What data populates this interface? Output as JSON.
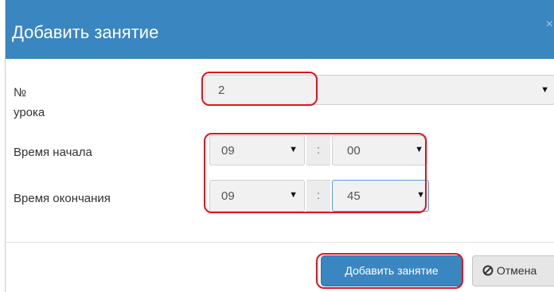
{
  "dialog": {
    "title": "Добавить занятие",
    "close_glyph": "×"
  },
  "form": {
    "lesson_number": {
      "label_line1": "№",
      "label_line2": "урока",
      "value": "2"
    },
    "start_time": {
      "label": "Время начала",
      "hour": "09",
      "minute": "00",
      "separator": ":"
    },
    "end_time": {
      "label": "Время окончания",
      "hour": "09",
      "minute": "45",
      "separator": ":"
    }
  },
  "footer": {
    "add_label": "Добавить занятие",
    "cancel_label": "Отмена",
    "cancel_icon": "ban-icon"
  },
  "colors": {
    "header": "#3a86c1",
    "highlight": "#e0141e"
  }
}
